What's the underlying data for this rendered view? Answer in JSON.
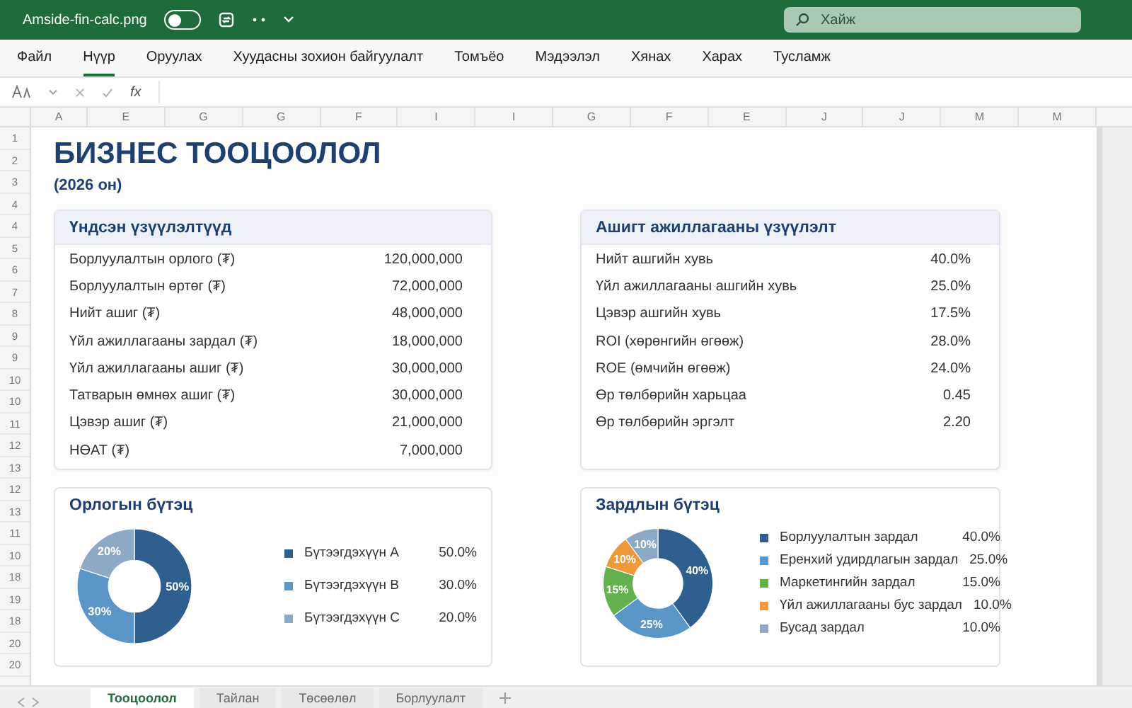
{
  "window": {
    "title": "Amside-fin-calc.png",
    "autosave_on": false,
    "search": {
      "placeholder": "Хайж"
    }
  },
  "ribbon_tabs": [
    {
      "label": "Файл",
      "selected": false
    },
    {
      "label": "Нүүр",
      "selected": true
    },
    {
      "label": "Оруулах",
      "selected": false
    },
    {
      "label": "Хуудасны зохион байгуулалт",
      "selected": false
    },
    {
      "label": "Томъёо",
      "selected": false
    },
    {
      "label": "Мэдээлэл",
      "selected": false
    },
    {
      "label": "Хянах",
      "selected": false
    },
    {
      "label": "Харах",
      "selected": false
    },
    {
      "label": "Тусламж",
      "selected": false
    }
  ],
  "formula_bar": {
    "function_label": "fx"
  },
  "column_headers": [
    "A",
    "E",
    "G",
    "G",
    "F",
    "I",
    "I",
    "G",
    "F",
    "E",
    "J",
    "J",
    "M",
    "M"
  ],
  "row_headers": [
    "1",
    "2",
    "3",
    "4",
    "4",
    "5",
    "6",
    "7",
    "8",
    "9",
    "9",
    "10",
    "10",
    "11",
    "12",
    "13",
    "12",
    "13",
    "11",
    "10",
    "18",
    "19",
    "18",
    "20",
    "20"
  ],
  "title": "БИЗНЕС ТООЦООЛОЛ",
  "subtitle": "(2026 он)",
  "key_indicators": {
    "title": "Үндсэн үзүүлэлтүүд",
    "rows": [
      {
        "label": "Борлуулалтын орлого (₮)",
        "value": "120,000,000"
      },
      {
        "label": "Борлуулалтын өртөг (₮)",
        "value": "72,000,000"
      },
      {
        "label": "Нийт ашиг (₮)",
        "value": "48,000,000"
      },
      {
        "label": "Үйл ажиллагааны зардал (₮)",
        "value": "18,000,000"
      },
      {
        "label": "Үйл ажиллагааны ашиг (₮)",
        "value": "30,000,000"
      },
      {
        "label": "Татварын өмнөх ашиг (₮)",
        "value": "30,000,000"
      },
      {
        "label": "Цэвэр ашиг (₮)",
        "value": "21,000,000"
      },
      {
        "label": "НӨАТ (₮)",
        "value": "7,000,000"
      }
    ]
  },
  "profitability": {
    "title": "Ашигт ажиллагааны үзүүлэлт",
    "rows": [
      {
        "label": "Нийт ашгийн хувь",
        "value": "40.0%"
      },
      {
        "label": "Үйл ажиллагааны ашгийн хувь",
        "value": "25.0%"
      },
      {
        "label": "Цэвэр ашгийн хувь",
        "value": "17.5%"
      },
      {
        "label": "ROI (хөрөнгийн өгөөж)",
        "value": "28.0%"
      },
      {
        "label": "ROE (өмчийн өгөөж)",
        "value": "24.0%"
      },
      {
        "label": "Өр төлбөрийн харьцаа",
        "value": "0.45"
      },
      {
        "label": "Өр төлбөрийн эргэлт",
        "value": "2.20"
      }
    ]
  },
  "revenue_structure": {
    "title": "Орлогын бүтэц",
    "chart_data": {
      "type": "donut",
      "categories": [
        "Бүтээгдэхүүн A",
        "Бүтээгдэхүүн B",
        "Бүтээгдэхүүн C"
      ],
      "values": [
        50,
        30,
        20
      ],
      "data_labels": true,
      "value_labels": [
        "50%",
        "30%",
        "20%"
      ]
    },
    "legend": [
      {
        "value": "50.0%",
        "color": "#2e5f8e"
      },
      {
        "value": "30.0%",
        "color": "#5a96c8"
      },
      {
        "value": "20.0%",
        "color": "#8ea9c6"
      }
    ]
  },
  "cost_structure": {
    "title": "Зардлын бүтэц",
    "chart_data": {
      "type": "donut",
      "categories": [
        "Борлуулалтын зардал",
        "Еренхий удирдлагын зардал",
        "Маркетингийн зардал",
        "Үйл ажиллагааны бус зардал",
        "Бусад зардал"
      ],
      "values": [
        40,
        25,
        15,
        10,
        10
      ],
      "data_labels": true,
      "value_labels": [
        "40%",
        "25%",
        "15%",
        "10%",
        "10%"
      ]
    },
    "legend": [
      {
        "value": "40.0%",
        "color": "#2e5f8e"
      },
      {
        "value": "25.0%",
        "color": "#5a96c8"
      },
      {
        "value": "15.0%",
        "color": "#62b04e"
      },
      {
        "value": "10.0%",
        "color": "#ee9a3a"
      },
      {
        "value": "10.0%",
        "color": "#8ea9c6"
      }
    ]
  },
  "sheet_tabs": [
    {
      "label": "Тооцоолол",
      "selected": true
    },
    {
      "label": "Тайлан",
      "selected": false
    },
    {
      "label": "Төсөөлөл",
      "selected": false
    },
    {
      "label": "Борлуулалт",
      "selected": false
    }
  ]
}
